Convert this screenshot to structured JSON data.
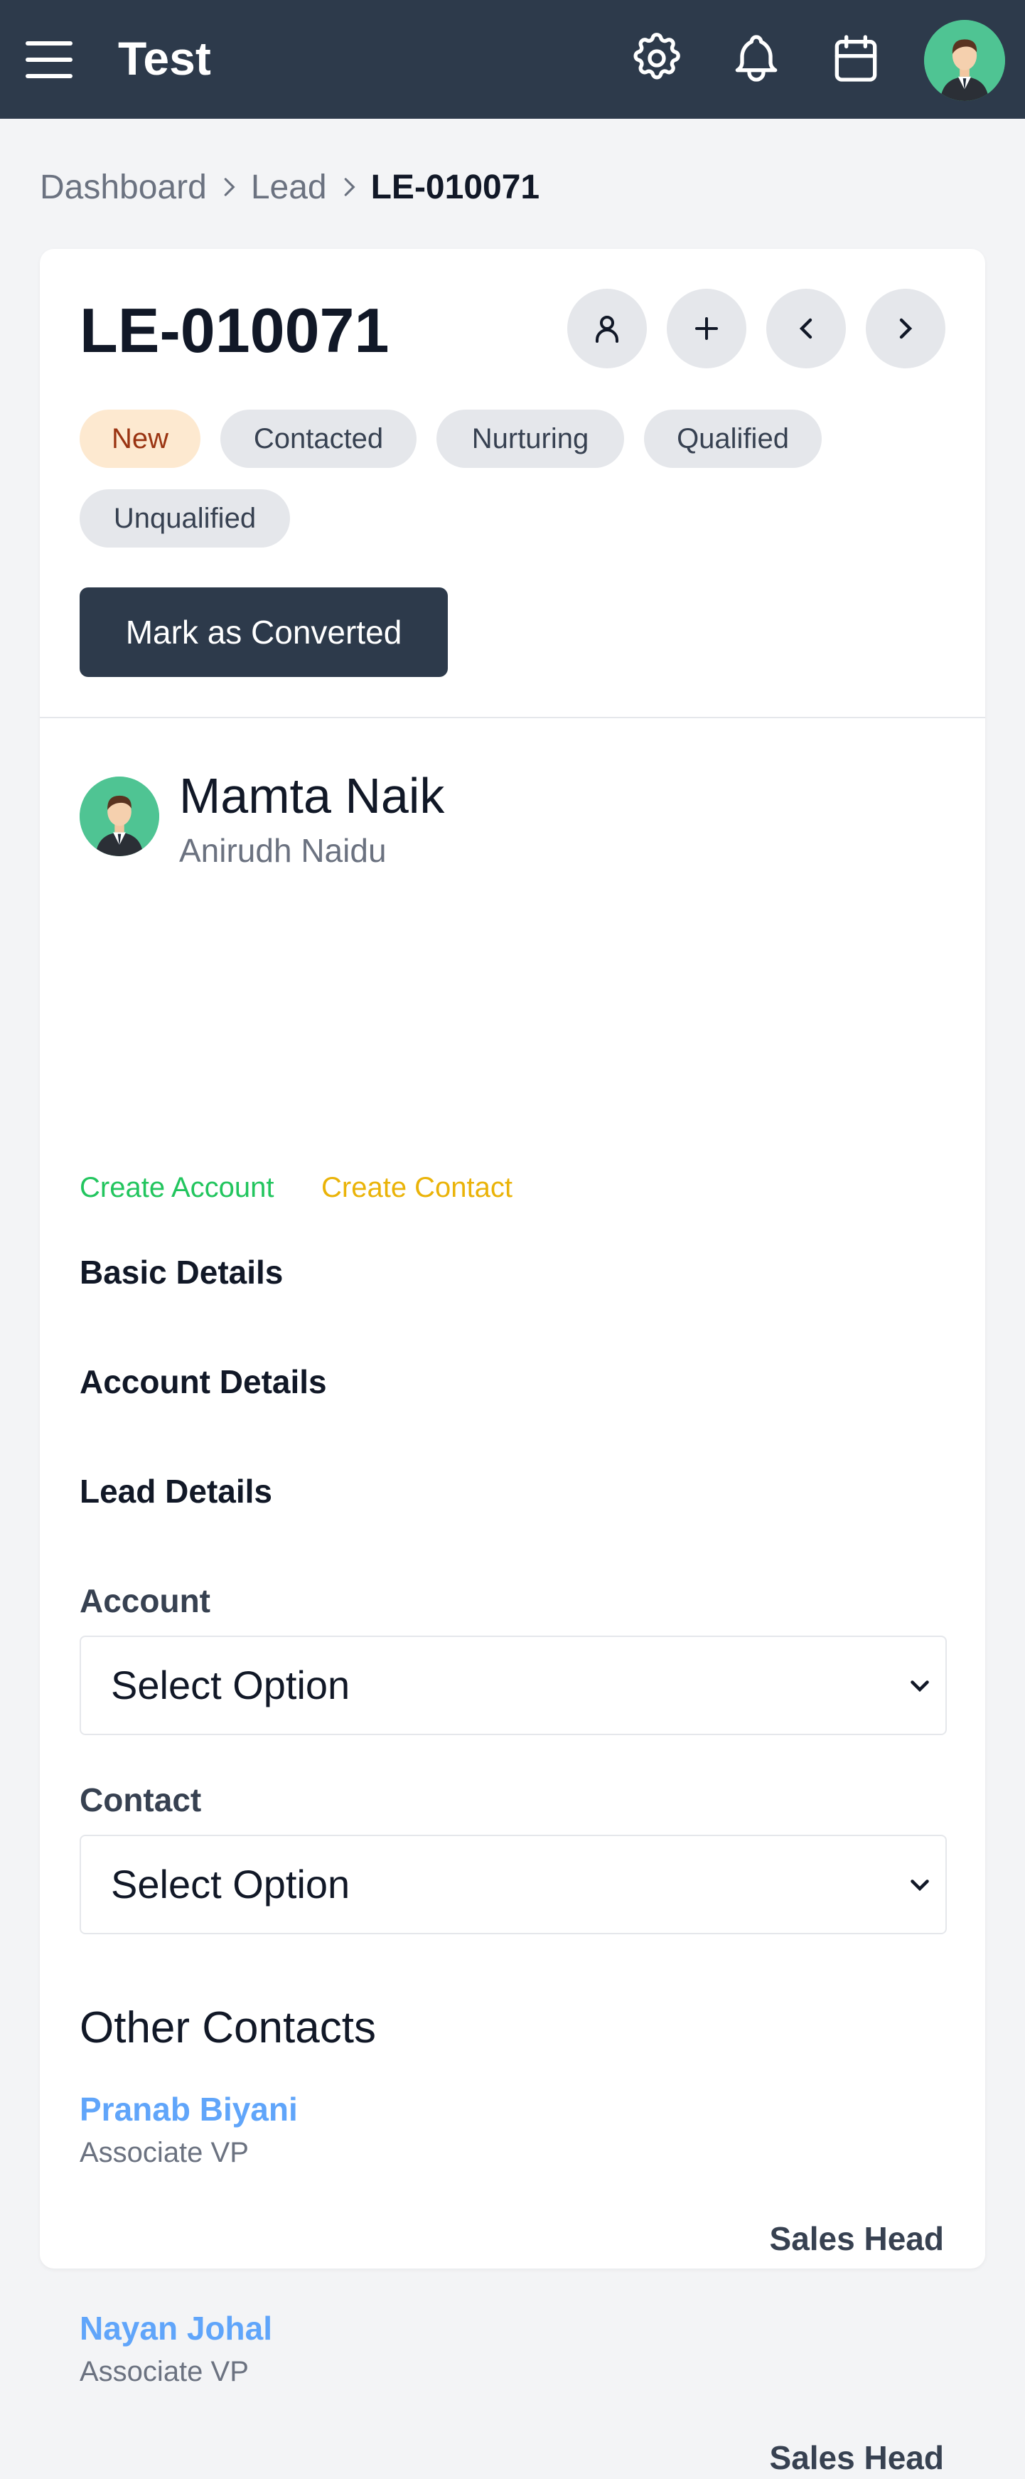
{
  "header": {
    "app_title": "Test",
    "icons": [
      "menu-icon",
      "gear-icon",
      "bell-icon",
      "calendar-icon",
      "avatar"
    ],
    "color": "#2d3a4b"
  },
  "breadcrumb": {
    "items": [
      "Dashboard",
      "Lead",
      "LE-010071"
    ]
  },
  "lead": {
    "id": "LE-010071",
    "action_icons": [
      "user-icon",
      "plus-icon",
      "chevron-left-icon",
      "chevron-right-icon"
    ],
    "statuses": [
      {
        "label": "New",
        "active": true
      },
      {
        "label": "Contacted",
        "active": false
      },
      {
        "label": "Nurturing",
        "active": false
      },
      {
        "label": "Qualified",
        "active": false
      },
      {
        "label": "Unqualified",
        "active": false
      }
    ],
    "convert_button": "Mark as Converted"
  },
  "person": {
    "name": "Mamta Naik",
    "owner": "Anirudh Naidu",
    "create_account": "Create Account",
    "create_contact": "Create Contact",
    "create_account_color": "#22c55e",
    "create_contact_color": "#eab308"
  },
  "sections": {
    "basic": "Basic Details",
    "account": "Account Details",
    "lead": "Lead Details"
  },
  "form": {
    "account_label": "Account",
    "account_value": "Select Option",
    "contact_label": "Contact",
    "contact_value": "Select Option"
  },
  "other_contacts": {
    "title": "Other Contacts",
    "items": [
      {
        "name": "Pranab Biyani",
        "role": "Associate VP",
        "dept": "Sales Head"
      },
      {
        "name": "Nayan Johal",
        "role": "Associate VP",
        "dept": "Sales Head"
      }
    ]
  }
}
